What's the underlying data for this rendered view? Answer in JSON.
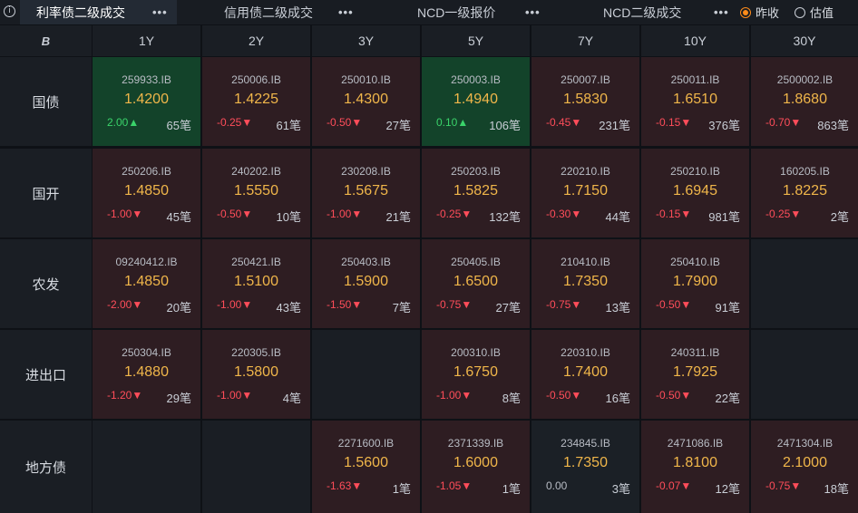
{
  "tabs": [
    {
      "label": "利率债二级成交",
      "more": "•••",
      "active": true
    },
    {
      "label": "信用债二级成交",
      "more": "•••",
      "active": false
    },
    {
      "label": "NCD一级报价",
      "more": "•••",
      "active": false
    },
    {
      "label": "NCD二级成交",
      "more": "•••",
      "active": false
    }
  ],
  "info_icon": "info-icon",
  "radios": [
    {
      "label": "昨收",
      "selected": true
    },
    {
      "label": "估值",
      "selected": false
    }
  ],
  "colors": {
    "up": "#3ad36a",
    "down": "#ff4d5a",
    "price": "#f0b64a",
    "accent": "#ff8c1a"
  },
  "header": {
    "corner": "B",
    "tenors": [
      "1Y",
      "2Y",
      "3Y",
      "5Y",
      "7Y",
      "10Y",
      "30Y"
    ]
  },
  "rows": [
    {
      "label": "国债",
      "cells": [
        {
          "code": "259933.IB",
          "price": "1.4200",
          "change": "2.00▲",
          "dir": "up",
          "count": "65笔"
        },
        {
          "code": "250006.IB",
          "price": "1.4225",
          "change": "-0.25▼",
          "dir": "down",
          "count": "61笔"
        },
        {
          "code": "250010.IB",
          "price": "1.4300",
          "change": "-0.50▼",
          "dir": "down",
          "count": "27笔"
        },
        {
          "code": "250003.IB",
          "price": "1.4940",
          "change": "0.10▲",
          "dir": "up",
          "count": "106笔"
        },
        {
          "code": "250007.IB",
          "price": "1.5830",
          "change": "-0.45▼",
          "dir": "down",
          "count": "231笔"
        },
        {
          "code": "250011.IB",
          "price": "1.6510",
          "change": "-0.15▼",
          "dir": "down",
          "count": "376笔"
        },
        {
          "code": "2500002.IB",
          "price": "1.8680",
          "change": "-0.70▼",
          "dir": "down",
          "count": "863笔"
        }
      ]
    },
    {
      "label": "国开",
      "cells": [
        {
          "code": "250206.IB",
          "price": "1.4850",
          "change": "-1.00▼",
          "dir": "down",
          "count": "45笔"
        },
        {
          "code": "240202.IB",
          "price": "1.5550",
          "change": "-0.50▼",
          "dir": "down",
          "count": "10笔"
        },
        {
          "code": "230208.IB",
          "price": "1.5675",
          "change": "-1.00▼",
          "dir": "down",
          "count": "21笔"
        },
        {
          "code": "250203.IB",
          "price": "1.5825",
          "change": "-0.25▼",
          "dir": "down",
          "count": "132笔"
        },
        {
          "code": "220210.IB",
          "price": "1.7150",
          "change": "-0.30▼",
          "dir": "down",
          "count": "44笔"
        },
        {
          "code": "250210.IB",
          "price": "1.6945",
          "change": "-0.15▼",
          "dir": "down",
          "count": "981笔"
        },
        {
          "code": "160205.IB",
          "price": "1.8225",
          "change": "-0.25▼",
          "dir": "down",
          "count": "2笔"
        }
      ]
    },
    {
      "label": "农发",
      "cells": [
        {
          "code": "09240412.IB",
          "price": "1.4850",
          "change": "-2.00▼",
          "dir": "down",
          "count": "20笔"
        },
        {
          "code": "250421.IB",
          "price": "1.5100",
          "change": "-1.00▼",
          "dir": "down",
          "count": "43笔"
        },
        {
          "code": "250403.IB",
          "price": "1.5900",
          "change": "-1.50▼",
          "dir": "down",
          "count": "7笔"
        },
        {
          "code": "250405.IB",
          "price": "1.6500",
          "change": "-0.75▼",
          "dir": "down",
          "count": "27笔"
        },
        {
          "code": "210410.IB",
          "price": "1.7350",
          "change": "-0.75▼",
          "dir": "down",
          "count": "13笔"
        },
        {
          "code": "250410.IB",
          "price": "1.7900",
          "change": "-0.50▼",
          "dir": "down",
          "count": "91笔"
        },
        null
      ]
    },
    {
      "label": "进出口",
      "cells": [
        {
          "code": "250304.IB",
          "price": "1.4880",
          "change": "-1.20▼",
          "dir": "down",
          "count": "29笔"
        },
        {
          "code": "220305.IB",
          "price": "1.5800",
          "change": "-1.00▼",
          "dir": "down",
          "count": "4笔"
        },
        null,
        {
          "code": "200310.IB",
          "price": "1.6750",
          "change": "-1.00▼",
          "dir": "down",
          "count": "8笔"
        },
        {
          "code": "220310.IB",
          "price": "1.7400",
          "change": "-0.50▼",
          "dir": "down",
          "count": "16笔"
        },
        {
          "code": "240311.IB",
          "price": "1.7925",
          "change": "-0.50▼",
          "dir": "down",
          "count": "22笔"
        },
        null
      ]
    },
    {
      "label": "地方债",
      "cells": [
        null,
        null,
        {
          "code": "2271600.IB",
          "price": "1.5600",
          "change": "-1.63▼",
          "dir": "down",
          "count": "1笔"
        },
        {
          "code": "2371339.IB",
          "price": "1.6000",
          "change": "-1.05▼",
          "dir": "down",
          "count": "1笔"
        },
        {
          "code": "234845.IB",
          "price": "1.7350",
          "change": "0.00",
          "dir": "flat",
          "count": "3笔"
        },
        {
          "code": "2471086.IB",
          "price": "1.8100",
          "change": "-0.07▼",
          "dir": "down",
          "count": "12笔"
        },
        {
          "code": "2471304.IB",
          "price": "2.1000",
          "change": "-0.75▼",
          "dir": "down",
          "count": "18笔"
        }
      ]
    }
  ]
}
